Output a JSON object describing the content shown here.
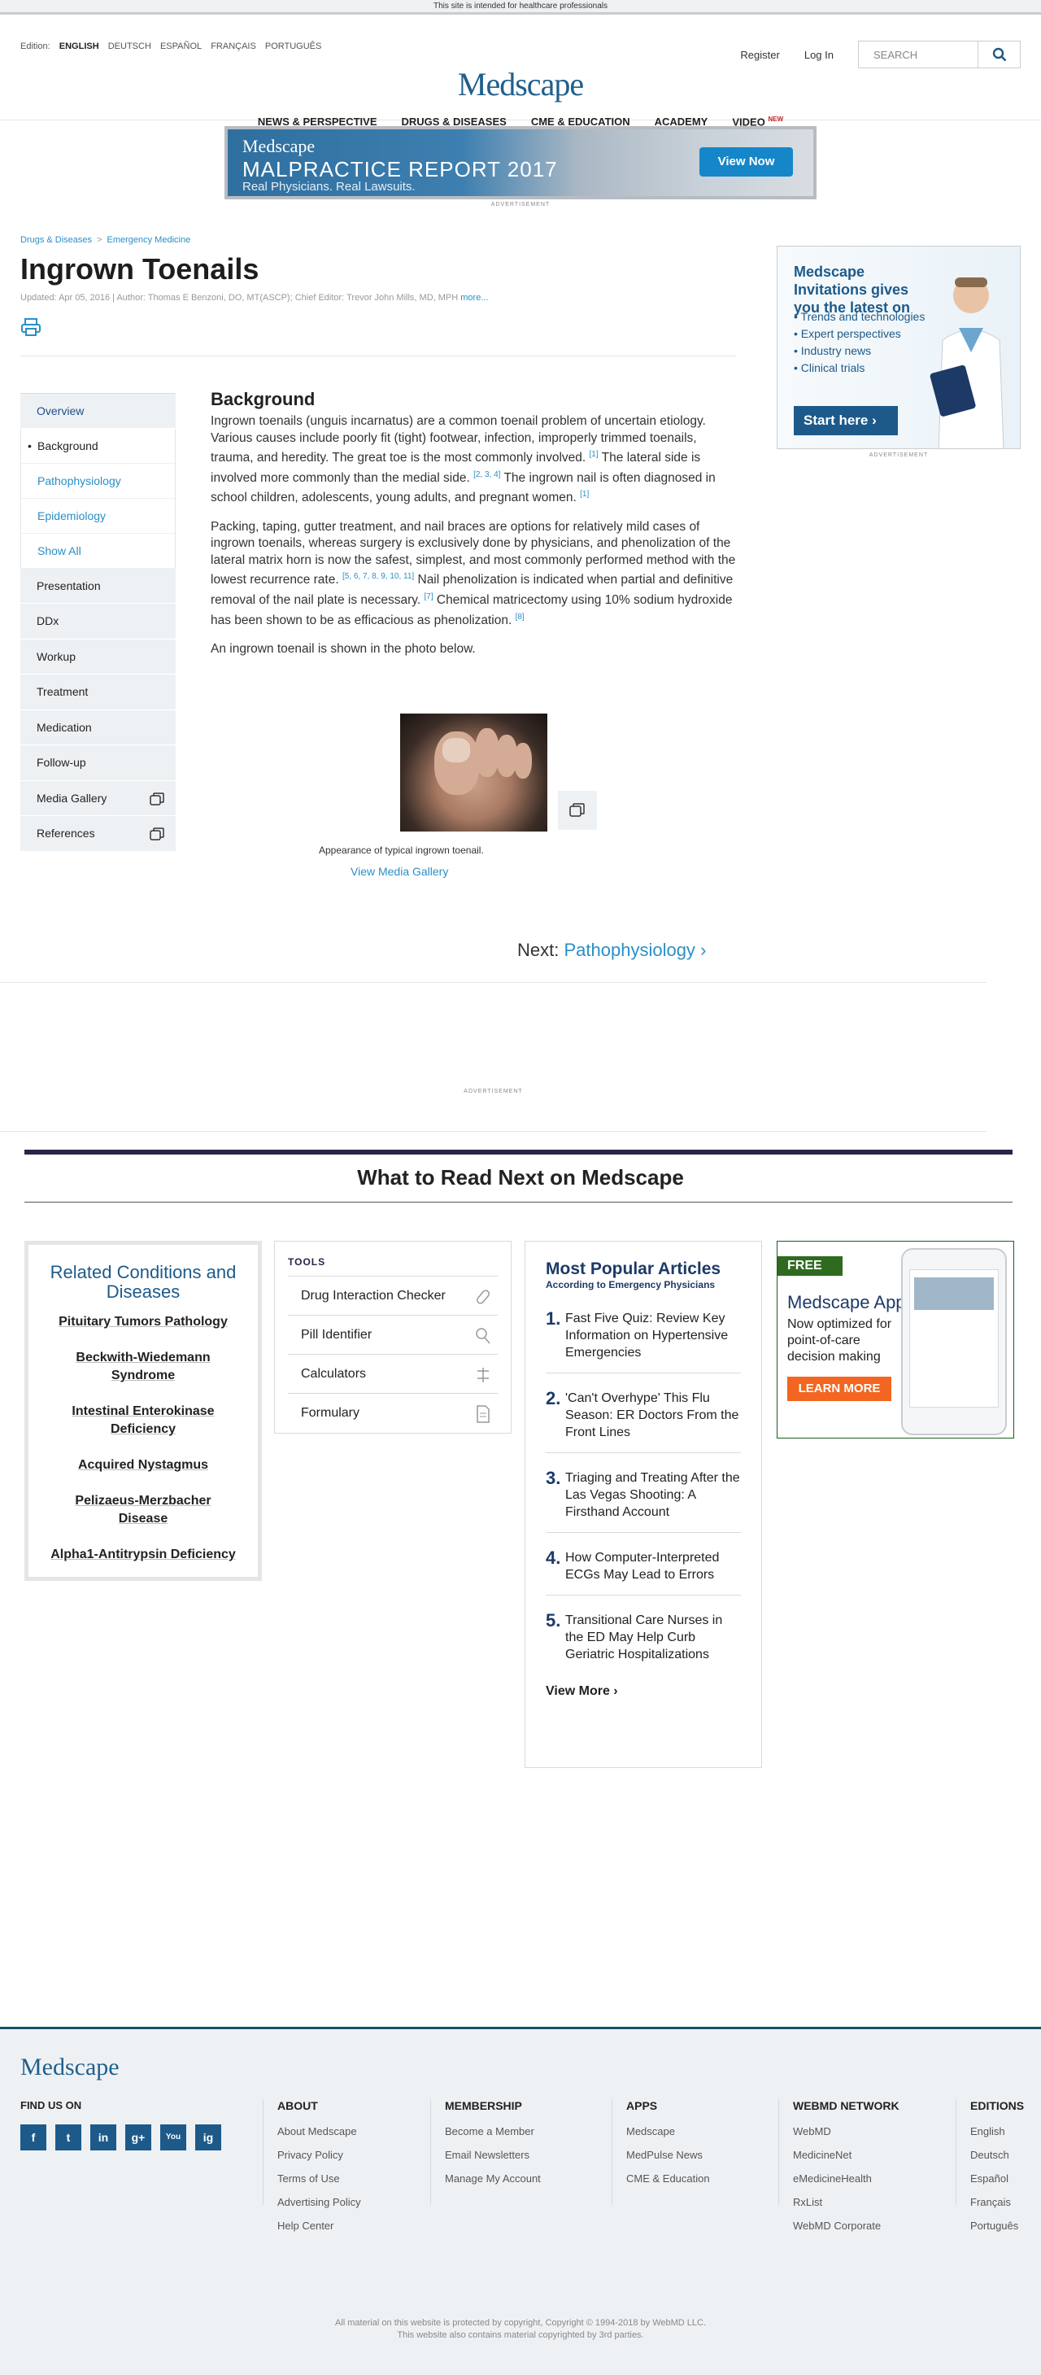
{
  "top_notice": "This site is intended for healthcare professionals",
  "header": {
    "edition_label": "Edition:",
    "editions": [
      "ENGLISH",
      "DEUTSCH",
      "ESPAÑOL",
      "FRANÇAIS",
      "PORTUGUÊS"
    ],
    "register": "Register",
    "login": "Log In",
    "search_placeholder": "SEARCH",
    "logo": "Medscape",
    "nav": [
      "NEWS & PERSPECTIVE",
      "DRUGS & DISEASES",
      "CME & EDUCATION",
      "ACADEMY",
      "VIDEO"
    ],
    "nav_badge": "NEW"
  },
  "banner_ad": {
    "brand": "Medscape",
    "headline": "MALPRACTICE REPORT 2017",
    "tagline": "Real Physicians. Real Lawsuits.",
    "button": "View Now",
    "label": "ADVERTISEMENT"
  },
  "breadcrumb": [
    "Drugs & Diseases",
    "Emergency Medicine"
  ],
  "breadcrumb_sep": ">",
  "page": {
    "title": "Ingrown Toenails",
    "meta": "Updated: Apr 05, 2016 | Author: Thomas E Benzoni, DO, MT(ASCP); Chief Editor: Trevor John Mills, MD, MPH",
    "meta_more": "more..."
  },
  "side_ad": {
    "title": "Medscape Invitations gives you the latest on",
    "bullets": [
      "• Trends and technologies",
      "• Expert perspectives",
      "• Industry news",
      "• Clinical trials"
    ],
    "button": "Start here",
    "label": "ADVERTISEMENT"
  },
  "toc": {
    "overview": "Overview",
    "sub": [
      "Background",
      "Pathophysiology",
      "Epidemiology",
      "Show All"
    ],
    "items": [
      "Presentation",
      "DDx",
      "Workup",
      "Treatment",
      "Medication",
      "Follow-up",
      "Media Gallery",
      "References"
    ]
  },
  "article": {
    "heading": "Background",
    "p1a": "Ingrown toenails (unguis incarnatus) are a common toenail problem of uncertain etiology. Various causes include poorly fit (tight) footwear, infection, improperly trimmed toenails, trauma, and heredity. The great toe is the most commonly involved.",
    "p1_ref1": "[1]",
    "p1b": " The lateral side is involved more commonly than the medial side.",
    "p1_ref2": "[2, 3, 4]",
    "p1c": " The ingrown nail is often diagnosed in school children, adolescents, young adults, and pregnant women.",
    "p1_ref3": "[1]",
    "p2a": "Packing, taping, gutter treatment, and nail braces are options for relatively mild cases of ingrown toenails, whereas surgery is exclusively done by physicians, and phenolization of the lateral matrix horn is now the safest, simplest, and most commonly performed method with the lowest recurrence rate.",
    "p2_ref1": "[5, 6, 7, 8, 9, 10, 11]",
    "p2b": " Nail phenolization is indicated when partial and definitive removal of the nail plate is necessary.",
    "p2_ref2": "[7]",
    "p2c": " Chemical matricectomy using 10% sodium hydroxide has been shown to be as efficacious as phenolization.",
    "p2_ref3": "[8]",
    "p3": "An ingrown toenail is shown in the photo below.",
    "caption": "Appearance of typical ingrown toenail.",
    "gallery_link": "View Media Gallery"
  },
  "next": {
    "label": "Next:",
    "link": "Pathophysiology"
  },
  "ad_label_2": "ADVERTISEMENT",
  "what_next": "What to Read Next on Medscape",
  "related": {
    "heading": "Related Conditions and Diseases",
    "items": [
      "Pituitary Tumors Pathology",
      "Beckwith-Wiedemann Syndrome",
      "Intestinal Enterokinase Deficiency",
      "Acquired Nystagmus",
      "Pelizaeus-Merzbacher Disease",
      "Alpha1-Antitrypsin Deficiency"
    ]
  },
  "tools": {
    "heading": "TOOLS",
    "items": [
      "Drug Interaction Checker",
      "Pill Identifier",
      "Calculators",
      "Formulary"
    ]
  },
  "popular": {
    "heading": "Most Popular Articles",
    "sub": "According to Emergency Physicians",
    "items": [
      "Fast Five Quiz: Review Key Information on Hypertensive Emergencies",
      "'Can't Overhype' This Flu Season: ER Doctors From the Front Lines",
      "Triaging and Treating After the Las Vegas Shooting: A Firsthand Account",
      "How Computer-Interpreted ECGs May Lead to Errors",
      "Transitional Care Nurses in the ED May Help Curb Geriatric Hospitalizations"
    ],
    "view_more": "View More"
  },
  "app_ad": {
    "badge": "FREE",
    "title": "Medscape App",
    "text": "Now optimized for point-of-care decision making",
    "button": "LEARN MORE"
  },
  "footer": {
    "logo": "Medscape",
    "find_us": "FIND US ON",
    "social": [
      "f",
      "t",
      "in",
      "g+",
      "You",
      "ig"
    ],
    "columns": [
      {
        "heading": "ABOUT",
        "links": [
          "About Medscape",
          "Privacy Policy",
          "Terms of Use",
          "Advertising Policy",
          "Help Center"
        ]
      },
      {
        "heading": "MEMBERSHIP",
        "links": [
          "Become a Member",
          "Email Newsletters",
          "Manage My Account"
        ]
      },
      {
        "heading": "APPS",
        "links": [
          "Medscape",
          "MedPulse News",
          "CME & Education"
        ]
      },
      {
        "heading": "WEBMD NETWORK",
        "links": [
          "WebMD",
          "MedicineNet",
          "eMedicineHealth",
          "RxList",
          "WebMD Corporate"
        ]
      },
      {
        "heading": "EDITIONS",
        "links": [
          "English",
          "Deutsch",
          "Español",
          "Français",
          "Português"
        ]
      }
    ],
    "copyright1": "All material on this website is protected by copyright, Copyright © 1994-2018 by WebMD LLC.",
    "copyright2": "This website also contains material copyrighted by 3rd parties."
  },
  "colors": {
    "brand_blue": "#1f5f8c",
    "link": "#2a8fc7",
    "dark_navy": "#2a2447",
    "cta_orange": "#f26622"
  }
}
